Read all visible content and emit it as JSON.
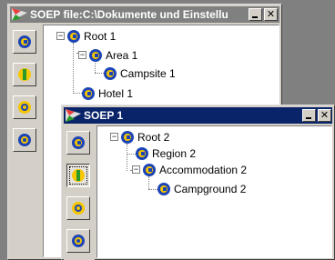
{
  "window1": {
    "title": "SOEP file:C:\\Dokumente und Einstellu",
    "minimize_label": "_",
    "close_label": "✕",
    "tree": [
      {
        "label": "Root 1",
        "expander": "−"
      },
      {
        "label": "Area 1",
        "expander": "−"
      },
      {
        "label": "Campsite 1"
      },
      {
        "label": "Hotel 1"
      }
    ],
    "tools": [
      "campsite-tool",
      "area-tool",
      "accommodation-tool",
      "region-tool"
    ]
  },
  "window2": {
    "title": "SOEP  1",
    "minimize_label": "_",
    "close_label": "✕",
    "tree": [
      {
        "label": "Root 2",
        "expander": "−"
      },
      {
        "label": "Region 2"
      },
      {
        "label": "Accommodation 2",
        "expander": "−"
      },
      {
        "label": "Campground 2"
      }
    ],
    "tools": [
      "campsite-tool",
      "area-tool",
      "accommodation-tool",
      "region-tool"
    ]
  },
  "colors": {
    "node_blue": "#1d44b5",
    "node_yellow": "#f6c700",
    "active_title": "#0a246a",
    "inactive_title": "#808080",
    "area_green": "#2a9a2a"
  }
}
